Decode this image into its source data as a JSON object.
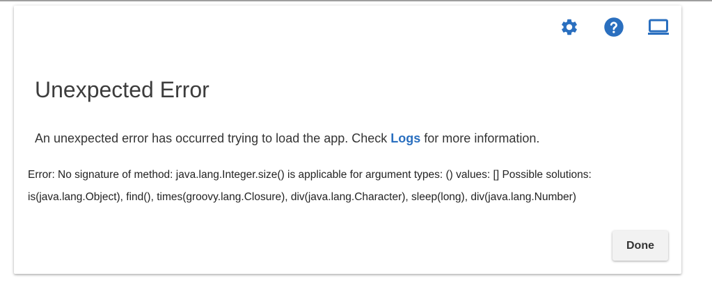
{
  "toolbar": {
    "icons": [
      "gear-icon",
      "help-icon",
      "laptop-icon"
    ],
    "icon_color": "#2a6fbf"
  },
  "dialog": {
    "title": "Unexpected Error",
    "message_before": "An unexpected error has occurred trying to load the app. Check ",
    "logs_link": "Logs",
    "message_after": " for more information.",
    "error_detail": "Error: No signature of method: java.lang.Integer.size() is applicable for argument types: () values: [] Possible solutions: is(java.lang.Object), find(), times(groovy.lang.Closure), div(java.lang.Character), sleep(long), div(java.lang.Number)",
    "done_label": "Done"
  }
}
